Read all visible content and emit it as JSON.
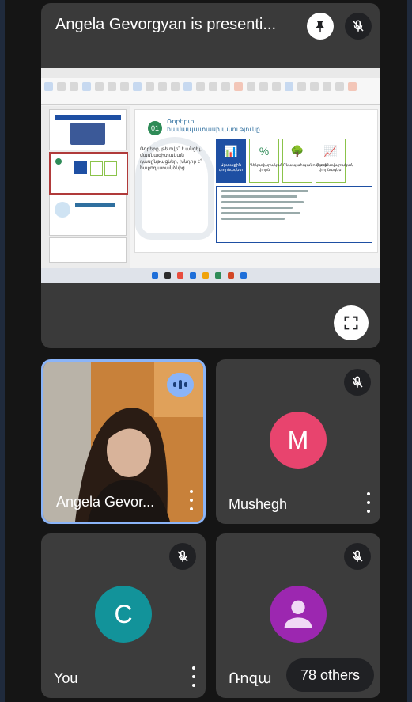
{
  "presentation": {
    "title": "Angela Gevorgyan is presenti...",
    "pin_icon": "pin-icon",
    "mic_off_icon": "mic-off-icon",
    "fullscreen_icon": "fullscreen-icon",
    "slide": {
      "number": "01",
      "title": "Ռոբերտ\nհամապատասխանությունը",
      "body": "Ռոբերը, թե ովե՞ է անցել, մասնագիտական դասընթացներ, խնդիր է՞ հաջող առանձնից...",
      "cards": [
        {
          "glyph": "📊",
          "label": "Արտաքին փորձագետ"
        },
        {
          "glyph": "%",
          "label": "Ղեկավարական փորձ"
        },
        {
          "glyph": "🌳",
          "label": "Բնապահպանություն"
        },
        {
          "glyph": "📈",
          "label": "Ռազմավարական փորձագետ"
        }
      ]
    }
  },
  "participants": [
    {
      "name": "Angela Gevor...",
      "speaking": true
    },
    {
      "name": "Mushegh",
      "initial": "M",
      "avatar_color": "#e8446e"
    },
    {
      "name": "You",
      "initial": "C",
      "avatar_color": "#12939a"
    },
    {
      "name": "Ռոզա",
      "avatar_color": "#9c27b0"
    }
  ],
  "others_label": "78 others",
  "colors": {
    "accent": "#8ab4f8",
    "tile": "#3c3c3c",
    "background": "#151515"
  }
}
